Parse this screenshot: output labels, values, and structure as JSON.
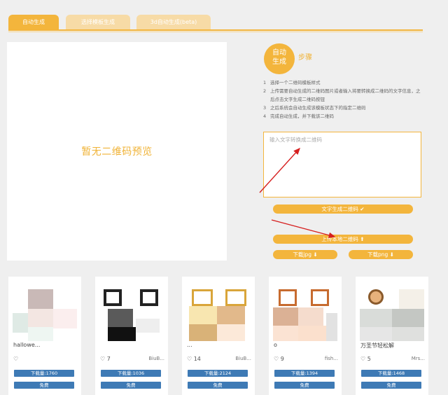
{
  "tabs": [
    "自动生成",
    "选择模板生成",
    "3d自动生成(beta)"
  ],
  "preview": {
    "placeholder": "暂无二维码预览"
  },
  "steps": {
    "circle": [
      "自动",
      "生成"
    ],
    "title": "步骤",
    "items": [
      "选择一个二维码模板样式",
      "上传需要自动生成的二维码图片或者输入将要转换成二维码的文字信息，之后点击文字生成二维码按钮",
      "之后系统会自动生成该模板状态下的指定二维码",
      "完成自动生成，并下载该二维码"
    ]
  },
  "input": {
    "placeholder": "输入文字转换成二维码"
  },
  "buttons": {
    "generate": "文字生成二维码 ✔",
    "upload": "上传本地二维码 ⬆",
    "download_jpg": "下载jpg ⬇",
    "download_png": "下载png ⬇"
  },
  "cards": [
    {
      "title": "hallowe...",
      "likes": "",
      "author": "",
      "downloads": "下载量:1760",
      "price": "免费"
    },
    {
      "title": "",
      "likes": "7",
      "author": "BiuB...",
      "downloads": "下载量:1036",
      "price": "免费"
    },
    {
      "title": "...",
      "likes": "14",
      "author": "BiuB...",
      "downloads": "下载量:2124",
      "price": "免费"
    },
    {
      "title": "o",
      "likes": "9",
      "author": "fish...",
      "downloads": "下载量:1394",
      "price": "免费"
    },
    {
      "title": "万圣节轻松解",
      "likes": "5",
      "author": "Mrs...",
      "downloads": "下载量:1468",
      "price": "免费"
    }
  ]
}
